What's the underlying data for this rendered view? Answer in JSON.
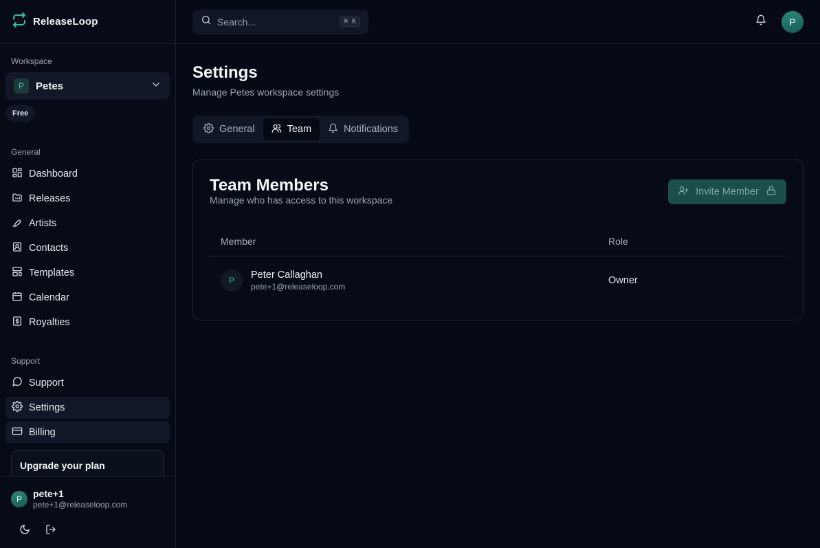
{
  "app": {
    "name": "ReleaseLoop",
    "accent": "#2d8a7b"
  },
  "sidebar": {
    "workspace_label": "Workspace",
    "workspace": {
      "initial": "P",
      "name": "Petes",
      "plan": "Free"
    },
    "general_label": "General",
    "general_items": [
      {
        "label": "Dashboard",
        "icon": "dashboard-icon"
      },
      {
        "label": "Releases",
        "icon": "releases-icon"
      },
      {
        "label": "Artists",
        "icon": "artists-icon"
      },
      {
        "label": "Contacts",
        "icon": "contacts-icon"
      },
      {
        "label": "Templates",
        "icon": "templates-icon"
      },
      {
        "label": "Calendar",
        "icon": "calendar-icon"
      },
      {
        "label": "Royalties",
        "icon": "royalties-icon"
      }
    ],
    "support_label": "Support",
    "support_items": [
      {
        "label": "Support",
        "icon": "support-icon"
      },
      {
        "label": "Settings",
        "icon": "settings-icon",
        "active": true
      },
      {
        "label": "Billing",
        "icon": "billing-icon",
        "active": true
      }
    ],
    "upgrade": {
      "title": "Upgrade your plan"
    },
    "user": {
      "initial": "P",
      "name": "pete+1",
      "email": "pete+1@releaseloop.com"
    }
  },
  "topbar": {
    "search_placeholder": "Search...",
    "shortcut": "⌘ K",
    "avatar_initial": "P"
  },
  "page": {
    "title": "Settings",
    "subtitle": "Manage Petes workspace settings",
    "tabs": [
      {
        "label": "General",
        "icon": "gear-icon"
      },
      {
        "label": "Team",
        "icon": "users-icon",
        "active": true
      },
      {
        "label": "Notifications",
        "icon": "bell-icon"
      }
    ]
  },
  "team": {
    "title": "Team Members",
    "description": "Manage who has access to this workspace",
    "invite_label": "Invite Member",
    "columns": {
      "member": "Member",
      "role": "Role"
    },
    "members": [
      {
        "initial": "P",
        "name": "Peter Callaghan",
        "email": "pete+1@releaseloop.com",
        "role": "Owner"
      }
    ]
  }
}
